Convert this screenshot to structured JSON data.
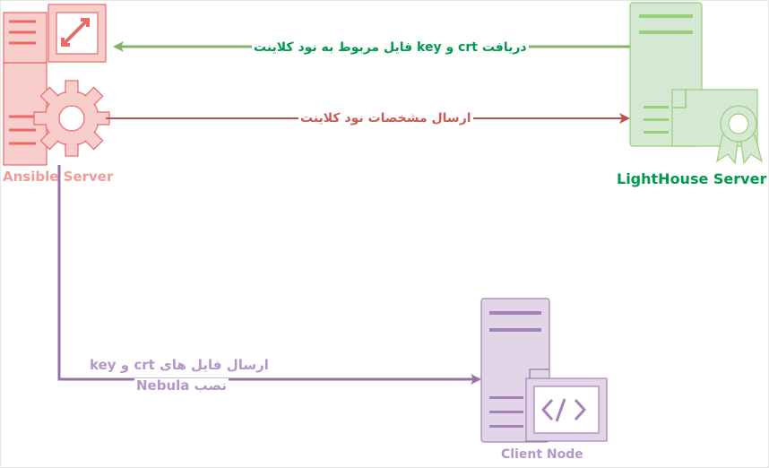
{
  "nodes": {
    "ansible": {
      "label": "Ansible Server",
      "color": "#f19c99",
      "fill": "#f8cecc",
      "stroke": "#ea6b66"
    },
    "lighthouse": {
      "label": "LightHouse Server",
      "color": "#00994d",
      "fill": "#d5e8d4",
      "stroke": "#97d077"
    },
    "client": {
      "label": "Client Node",
      "color": "#b596c9",
      "fill": "#e1d5e7",
      "stroke": "#a680b8"
    }
  },
  "edges": {
    "lighthouse_to_ansible": {
      "label": "دریافت crt و  key فایل مربوط به نود کلاینت",
      "color": "#82b366",
      "text_color": "#00994d"
    },
    "ansible_to_lighthouse": {
      "label": "ارسال مشخصات نود کلاینت",
      "color": "#b85450",
      "text_color": "#cc5a55"
    },
    "ansible_to_client": {
      "line1": "ارسال فایل های crt و key",
      "line2": "نصب Nebula",
      "color": "#9673a6",
      "text_color": "#b596c9"
    }
  }
}
